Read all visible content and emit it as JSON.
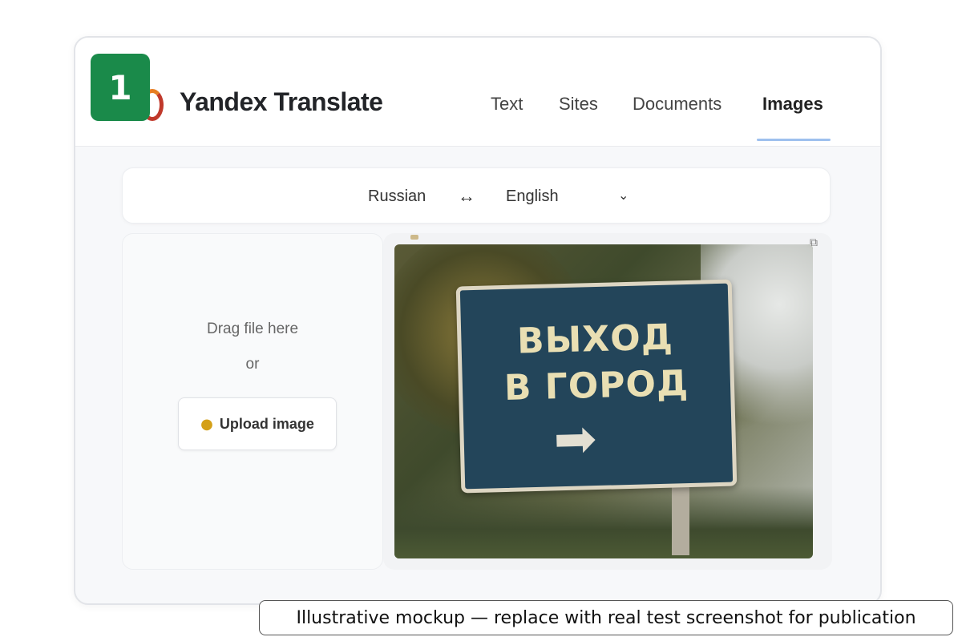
{
  "badge": {
    "number": "1"
  },
  "header": {
    "app_title": "Yandex Translate",
    "tabs": [
      {
        "label": "Text"
      },
      {
        "label": "Sites"
      },
      {
        "label": "Documents"
      },
      {
        "label": "Images",
        "active": true
      }
    ]
  },
  "language_bar": {
    "source": "Russian",
    "swap_icon": "↔",
    "target": "English",
    "chevron_icon": "⌄"
  },
  "drop_zone": {
    "drag_text": "Drag file here",
    "or_text": "or",
    "upload_icon": "⛹",
    "upload_label": "Upload image"
  },
  "image": {
    "sign_line1": "ВЫХОД",
    "sign_line2": "В ГОРОД",
    "arrow": "➡",
    "expand_icon": "⧉"
  },
  "caption": "Illustrative mockup — replace with real test screenshot for publication",
  "colors": {
    "badge": "#1a8a4a",
    "active_tab_underline": "#9ec0ee",
    "sign": "#23455a",
    "sign_text": "#e9dfb3"
  }
}
